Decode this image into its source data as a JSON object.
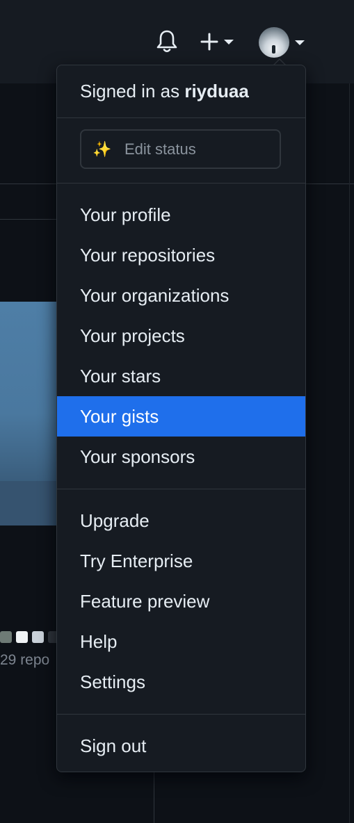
{
  "header": {
    "notifications_icon": "bell-icon",
    "create_icon": "plus-icon",
    "caret_icon": "triangle-down-icon"
  },
  "background": {
    "repo_count_text": "29 repo",
    "contribution_colors": [
      "#6e7b76",
      "#f0f3f5",
      "#c9d1d9",
      "#30363d"
    ]
  },
  "dropdown": {
    "signed_in_prefix": "Signed in as",
    "username": "riyduaa",
    "status": {
      "icon": "sparkles-icon",
      "icon_glyph": "✨",
      "label": "Edit status"
    },
    "section1": [
      {
        "label": "Your profile"
      },
      {
        "label": "Your repositories"
      },
      {
        "label": "Your organizations"
      },
      {
        "label": "Your projects"
      },
      {
        "label": "Your stars"
      },
      {
        "label": "Your gists"
      },
      {
        "label": "Your sponsors"
      }
    ],
    "active_item": "Your gists",
    "section2": [
      {
        "label": "Upgrade"
      },
      {
        "label": "Try Enterprise"
      },
      {
        "label": "Feature preview"
      },
      {
        "label": "Help"
      },
      {
        "label": "Settings"
      }
    ],
    "section3": [
      {
        "label": "Sign out"
      }
    ]
  },
  "colors": {
    "accent": "#1f6feb",
    "background": "#0d1117",
    "surface": "#161b22",
    "border": "#30363d",
    "text": "#e6edf3",
    "muted": "#8b949e"
  }
}
